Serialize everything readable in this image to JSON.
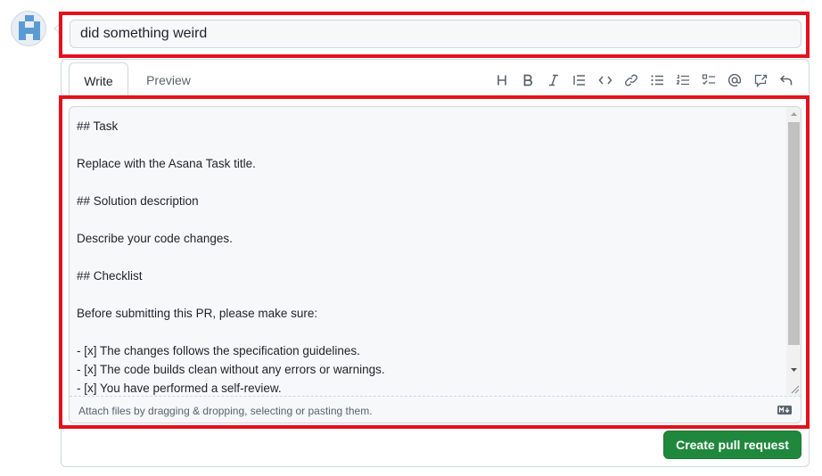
{
  "title": {
    "value": "did something weird"
  },
  "tabs": [
    {
      "label": "Write",
      "active": true
    },
    {
      "label": "Preview",
      "active": false
    }
  ],
  "toolbar": {
    "icons": [
      "heading-icon",
      "bold-icon",
      "italic-icon",
      "quote-icon",
      "code-icon",
      "link-icon",
      "unordered-list-icon",
      "ordered-list-icon",
      "task-list-icon",
      "mention-icon",
      "cross-reference-icon",
      "undo-icon"
    ]
  },
  "editor": {
    "lines": [
      "## Task",
      "",
      "Replace with the Asana Task title.",
      "",
      "## Solution description",
      "",
      "Describe your code changes.",
      "",
      "## Checklist",
      "",
      "Before submitting this PR, please make sure:",
      "",
      "- [x] The changes follows the specification guidelines.",
      "- [x] The code builds clean without any errors or warnings.",
      "- [x] You have performed a self-review."
    ],
    "attach_hint": "Attach files by dragging & dropping, selecting or pasting them.",
    "markdown_icon": "markdown-icon"
  },
  "actions": {
    "create_label": "Create pull request"
  },
  "colors": {
    "highlight": "#e3111e",
    "primary_button": "#1f883d",
    "muted_text": "#59636e",
    "border": "#d0d7de"
  }
}
